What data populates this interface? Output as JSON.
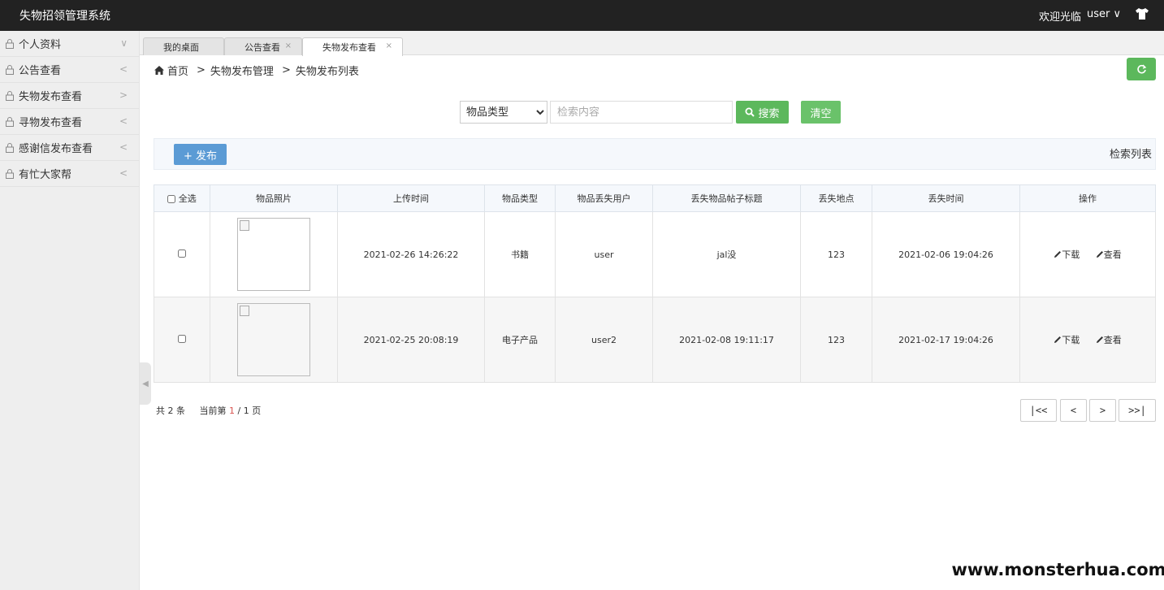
{
  "topbar": {
    "app_title": "失物招领管理系统",
    "welcome": "欢迎光临",
    "user": "user ∨"
  },
  "sidebar": {
    "items": [
      {
        "label": "个人资料",
        "chev": "∨"
      },
      {
        "label": "公告查看",
        "chev": "<"
      },
      {
        "label": "失物发布查看",
        "chev": ">"
      },
      {
        "label": "寻物发布查看",
        "chev": "<"
      },
      {
        "label": "感谢信发布查看",
        "chev": "<"
      },
      {
        "label": "有忙大家帮",
        "chev": "<"
      }
    ],
    "collapse_arrow": "◀"
  },
  "tabs": [
    {
      "label": "我的桌面"
    },
    {
      "label": "公告查看",
      "close": "×"
    },
    {
      "label": "失物发布查看",
      "close": "×"
    }
  ],
  "breadcrumb": {
    "home": "首页",
    "sep": ">",
    "level1": "失物发布管理",
    "level2": "失物发布列表"
  },
  "search": {
    "select_value": "物品类型",
    "placeholder": "检索内容",
    "search_label": "搜索",
    "clear_label": "清空"
  },
  "toolbar": {
    "publish_label": "+ 发布",
    "list_label": "检索列表"
  },
  "table": {
    "headers": [
      "全选",
      "物品照片",
      "上传时间",
      "物品类型",
      "物品丢失用户",
      "丢失物品帖子标题",
      "丢失地点",
      "丢失时间",
      "操作"
    ],
    "rows": [
      {
        "upload_time": "2021-02-26 14:26:22",
        "type": "书籍",
        "user": "user",
        "title": "jal没",
        "place": "123",
        "lost_time": "2021-02-06 19:04:26"
      },
      {
        "upload_time": "2021-02-25 20:08:19",
        "type": "电子产品",
        "user": "user2",
        "title": "2021-02-08 19:11:17",
        "place": "123",
        "lost_time": "2021-02-17 19:04:26"
      }
    ],
    "op_download": "下载",
    "op_view": "查看"
  },
  "footer": {
    "total_prefix": "共",
    "total": "2",
    "total_suffix": "条",
    "page_prefix": "当前第",
    "current_page": "1",
    "page_sep": "/",
    "total_pages": "1",
    "page_suffix": "页"
  },
  "pager": {
    "first": "|<<",
    "prev": "<",
    "next": ">",
    "last": ">>|"
  },
  "watermark": "www.monsterhua.com",
  "colors": {
    "topbar": "#222222",
    "green": "#5cb85c",
    "blue": "#5b9bd5",
    "highlight": "#d9534f"
  }
}
